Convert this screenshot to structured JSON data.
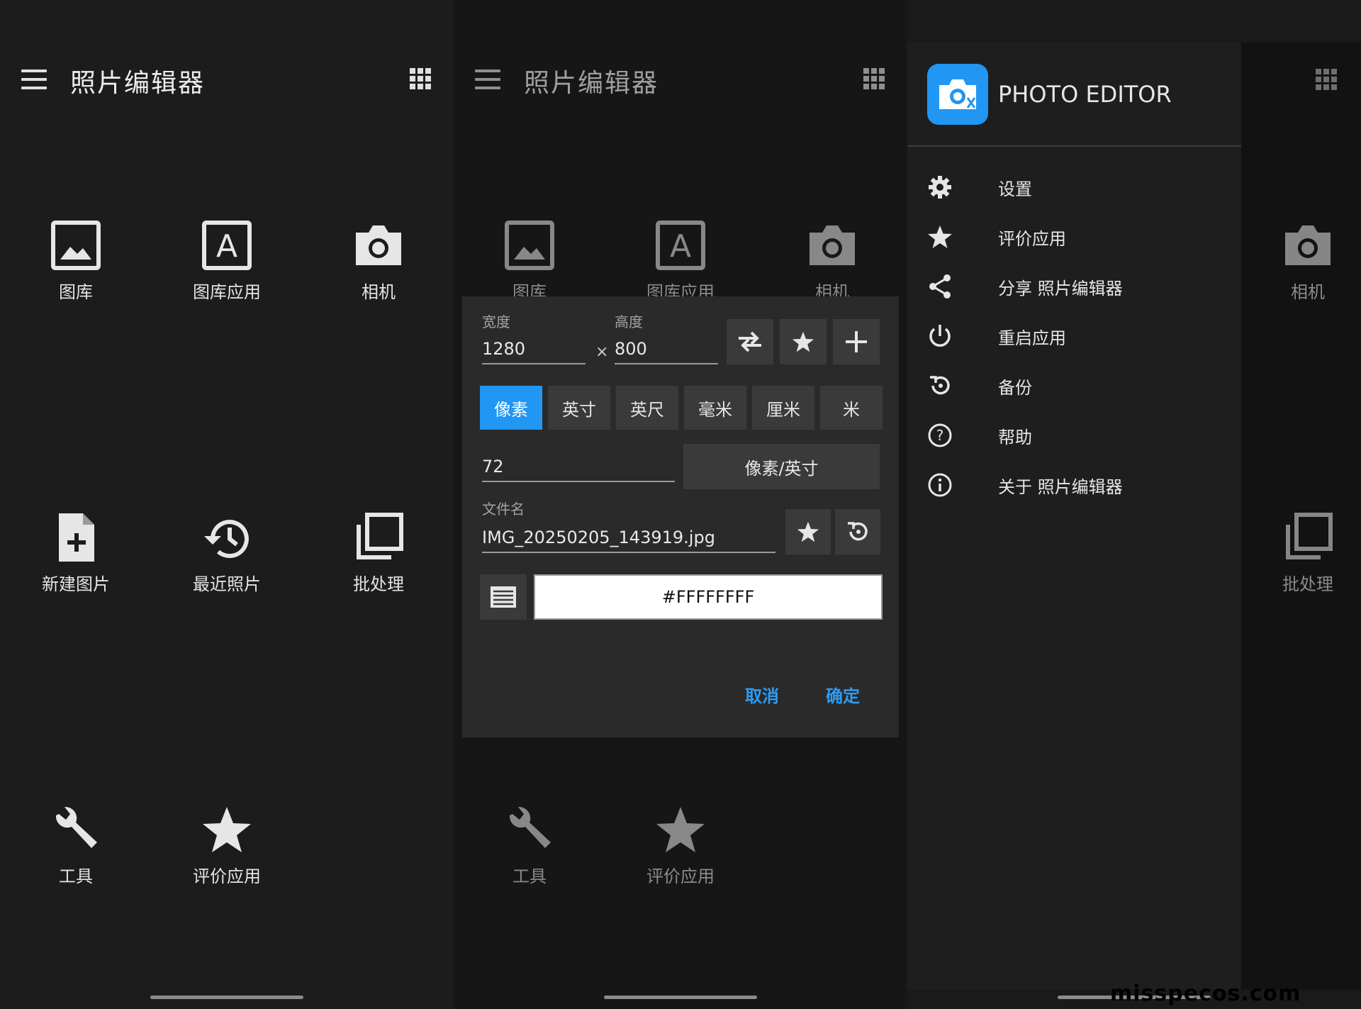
{
  "app_title": "照片编辑器",
  "tiles": {
    "gallery": "图库",
    "gallery_app": "图库应用",
    "camera": "相机",
    "new_image": "新建图片",
    "recent": "最近照片",
    "batch": "批处理",
    "tools": "工具",
    "rate": "评价应用"
  },
  "dialog": {
    "width_label": "宽度",
    "width_value": "1280",
    "times": "×",
    "height_label": "高度",
    "height_value": "800",
    "units": [
      "像素",
      "英寸",
      "英尺",
      "毫米",
      "厘米",
      "米"
    ],
    "selected_unit": "像素",
    "dpi_value": "72",
    "dpi_unit": "像素/英寸",
    "filename_label": "文件名",
    "filename_value": "IMG_20250205_143919.jpg",
    "color_value": "#FFFFFFFF",
    "cancel": "取消",
    "ok": "确定"
  },
  "drawer": {
    "title": "PHOTO EDITOR",
    "items": [
      {
        "label": "设置",
        "icon": "gear-icon"
      },
      {
        "label": "评价应用",
        "icon": "star-icon"
      },
      {
        "label": "分享 照片编辑器",
        "icon": "share-icon"
      },
      {
        "label": "重启应用",
        "icon": "power-icon"
      },
      {
        "label": "备份",
        "icon": "backup-icon"
      },
      {
        "label": "帮助",
        "icon": "help-icon"
      },
      {
        "label": "关于 照片编辑器",
        "icon": "info-icon"
      }
    ]
  },
  "watermark": "misspecos.com",
  "colors": {
    "accent": "#2196f3",
    "background": "#1c1c1c",
    "dialog": "#2a2a2a"
  }
}
